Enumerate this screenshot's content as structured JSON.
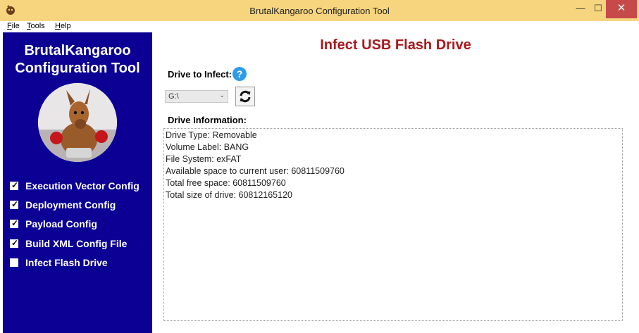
{
  "window": {
    "title": "BrutalKangaroo Configuration Tool",
    "minimize_glyph": "—",
    "maximize_glyph": "☐",
    "close_glyph": "✕"
  },
  "menu": {
    "file": "File",
    "tools": "Tools",
    "help": "Help"
  },
  "sidebar": {
    "title_line1": "BrutalKangaroo",
    "title_line2": "Configuration Tool",
    "steps": [
      {
        "label": "Execution Vector Config",
        "checked": true
      },
      {
        "label": "Deployment Config",
        "checked": true
      },
      {
        "label": "Payload Config",
        "checked": true
      },
      {
        "label": "Build XML Config File",
        "checked": true
      },
      {
        "label": "Infect Flash Drive",
        "checked": false
      }
    ],
    "check_glyph": "✓"
  },
  "main": {
    "heading": "Infect USB Flash Drive",
    "drive_to_infect_label": "Drive to Infect:",
    "help_glyph": "?",
    "drive_selected": "G:\\",
    "drive_arrow_glyph": "⌄",
    "drive_information_label": "Drive Information:",
    "drive_info_lines": [
      "Drive Type: Removable",
      "Volume Label: BANG",
      "File System: exFAT",
      "Available space to current user: 60811509760",
      "Total free space: 60811509760",
      "Total size of drive: 60812165120"
    ]
  },
  "icons": {
    "app": "kangaroo-app-icon",
    "help": "help-icon",
    "refresh": "refresh-icon",
    "mascot": "kangaroo-mascot-icon"
  },
  "colors": {
    "titlebar": "#f6d57e",
    "sidebar": "#0b0093",
    "heading": "#a9191d",
    "close": "#c74a4a",
    "help": "#2e9be6"
  }
}
